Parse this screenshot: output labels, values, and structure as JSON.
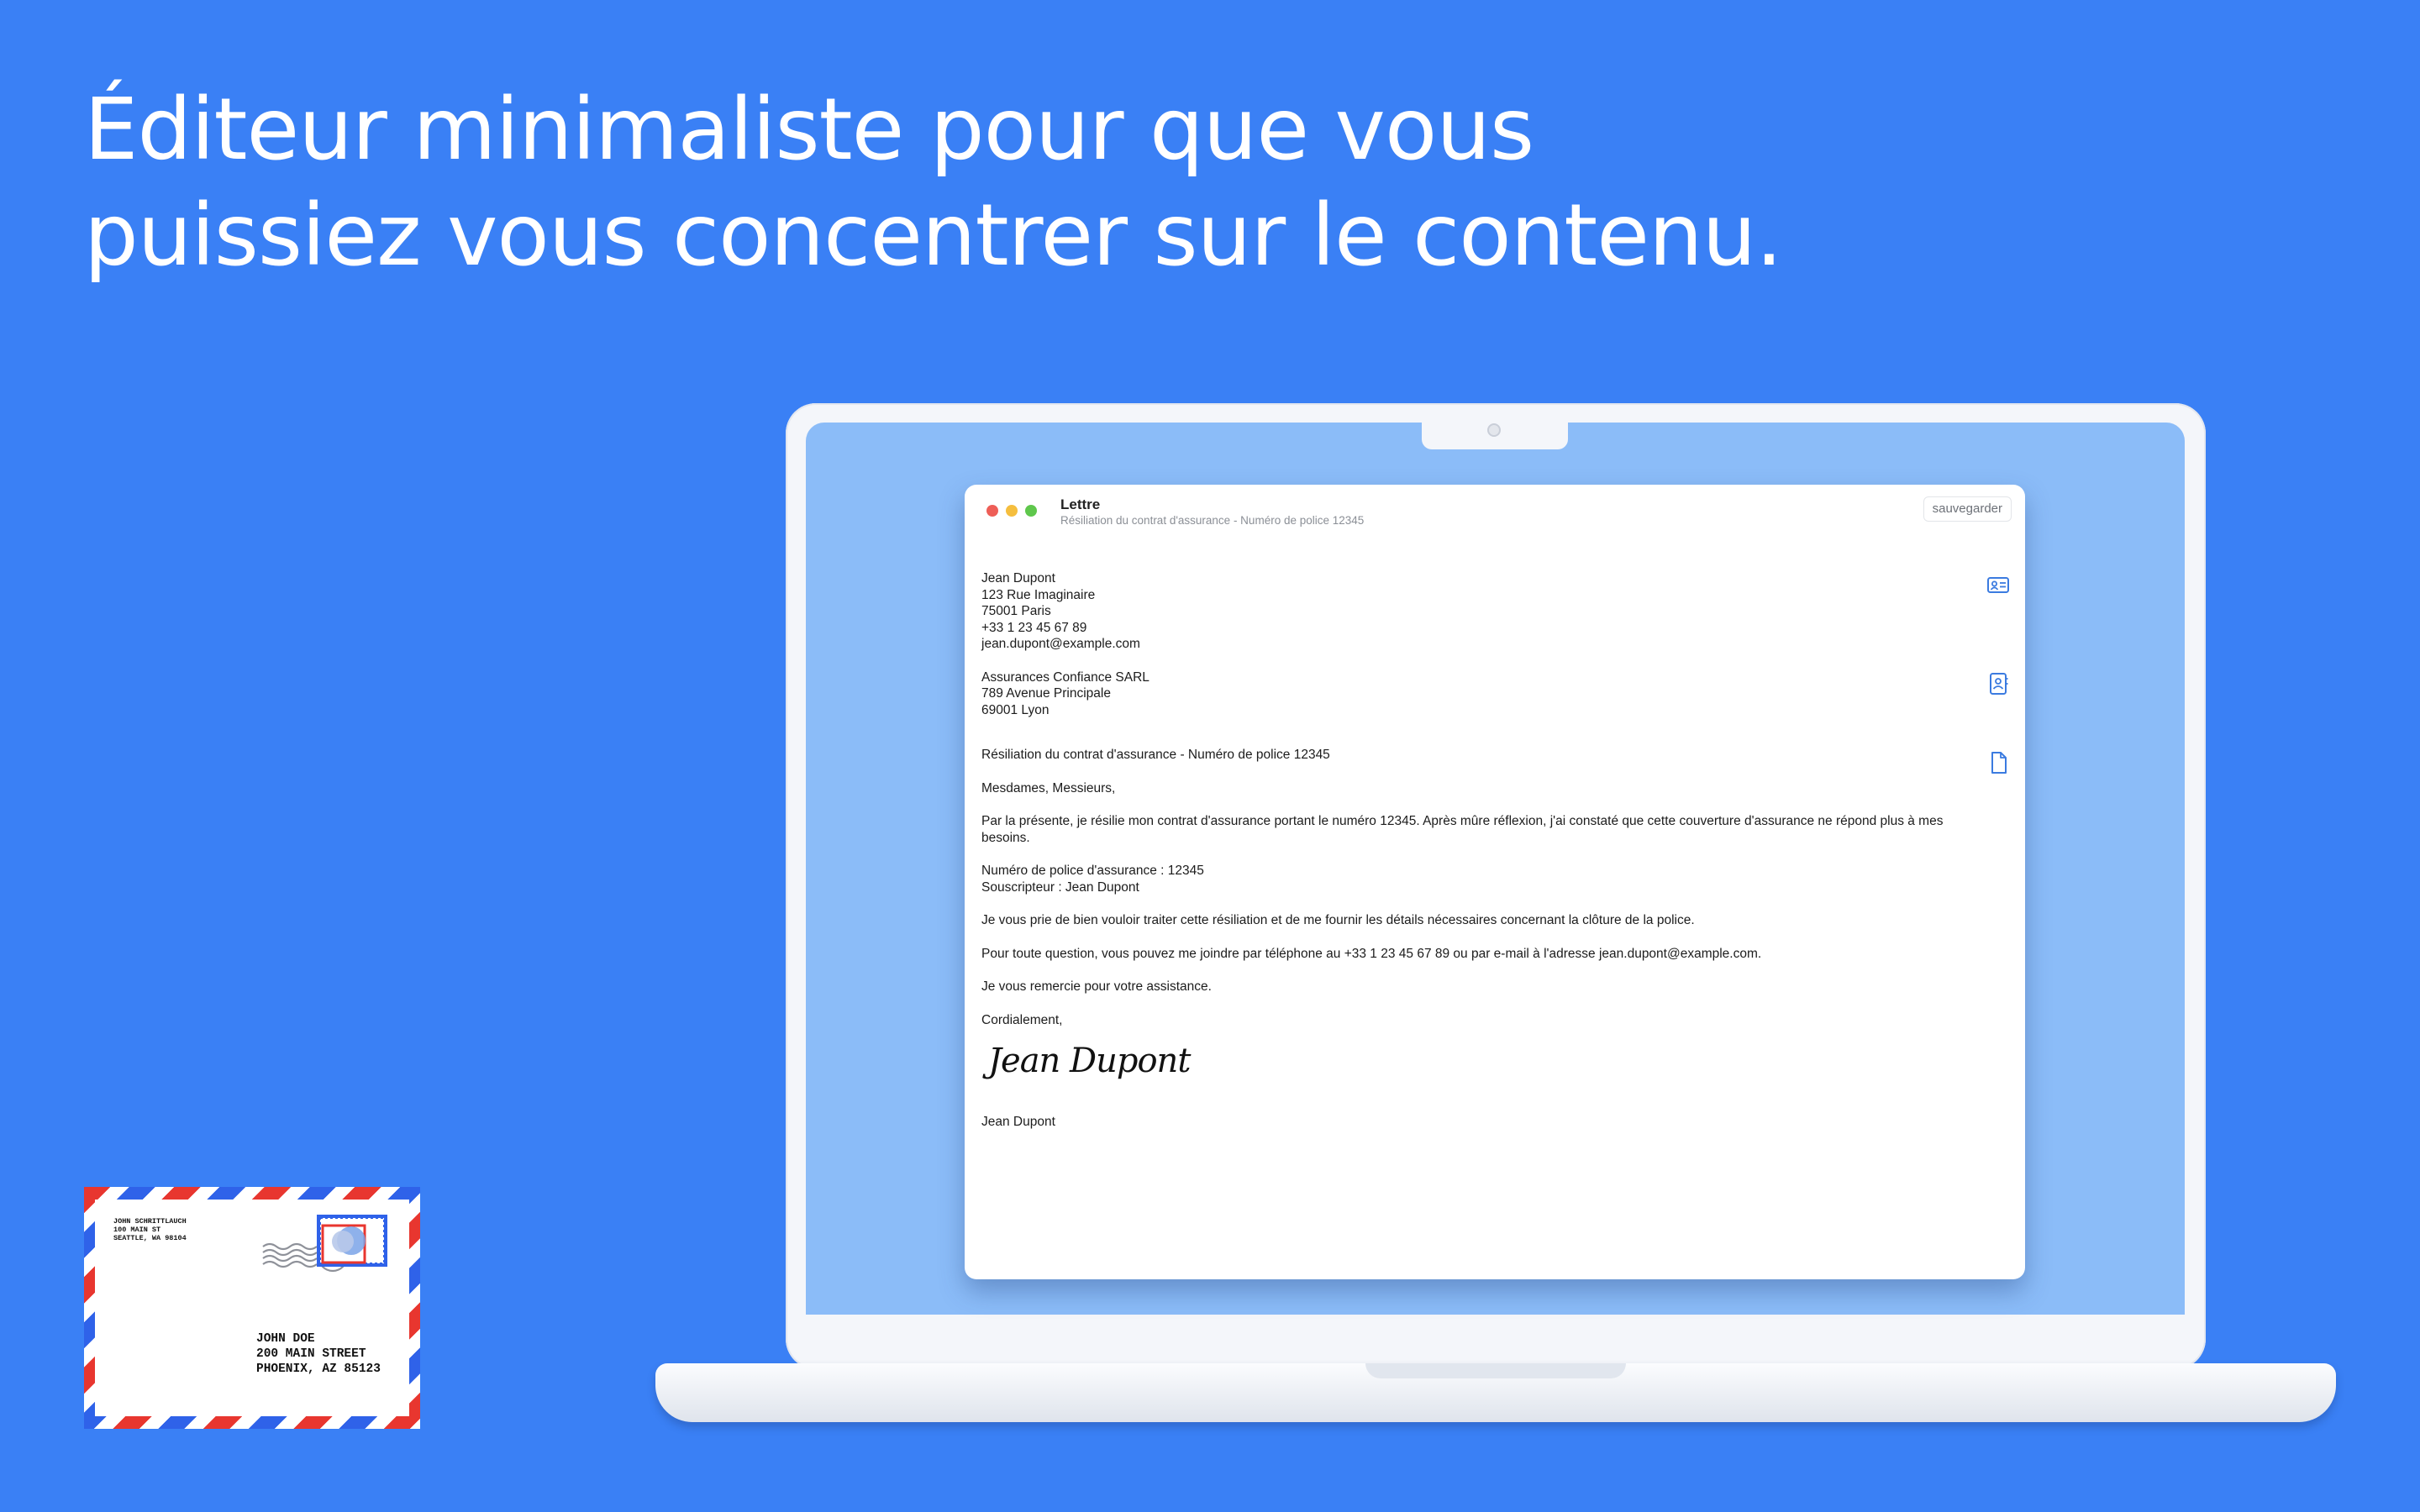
{
  "headline": {
    "line1": "Éditeur minimaliste pour que vous",
    "line2": "puissiez vous concentrer sur le contenu."
  },
  "window": {
    "title": "Lettre",
    "subtitle": "Résiliation du contrat d'assurance - Numéro de police 12345",
    "save_label": "sauvegarder"
  },
  "letter": {
    "sender": [
      "Jean Dupont",
      "123 Rue Imaginaire",
      "75001 Paris",
      "+33 1 23 45 67 89",
      "jean.dupont@example.com"
    ],
    "recipient": [
      "Assurances Confiance SARL",
      "789 Avenue Principale",
      "69001 Lyon"
    ],
    "subject": "Résiliation du contrat d'assurance - Numéro de police 12345",
    "salutation": "Mesdames, Messieurs,",
    "body1": "Par la présente, je résilie mon contrat d'assurance portant le numéro 12345. Après mûre réflexion, j'ai constaté que cette couverture d'assurance ne répond plus à mes besoins.",
    "policy_number": "Numéro de police d'assurance : 12345",
    "subscriber": "Souscripteur : Jean Dupont",
    "body2": "Je vous prie de bien vouloir traiter cette résiliation et de me fournir les détails nécessaires concernant la clôture de la police.",
    "body3": "Pour toute question, vous pouvez me joindre par téléphone au +33 1 23 45 67 89 ou par e-mail à l'adresse jean.dupont@example.com.",
    "body4": "Je vous remercie pour votre assistance.",
    "closing": "Cordialement,",
    "signature": "Jean Dupont",
    "signer_name": "Jean Dupont"
  },
  "icons": {
    "sender_contact": "contact-card-icon",
    "recipient_contact": "address-book-icon",
    "subject_document": "document-icon"
  },
  "envelope": {
    "sender": [
      "JOHN SCHRITTLAUCH",
      "100 MAIN ST",
      "SEATTLE, WA 98104"
    ],
    "recipient": [
      "JOHN DOE",
      "200 MAIN STREET",
      "PHOENIX, AZ 85123"
    ]
  },
  "colors": {
    "background": "#3a80f5",
    "screen": "#8bbcf8",
    "traffic_red": "#ee5e57",
    "traffic_yellow": "#f5be3e",
    "traffic_green": "#5fc74c",
    "icon_blue": "#3b7be0",
    "envelope_red": "#e8362f",
    "envelope_blue": "#2f62e9"
  }
}
